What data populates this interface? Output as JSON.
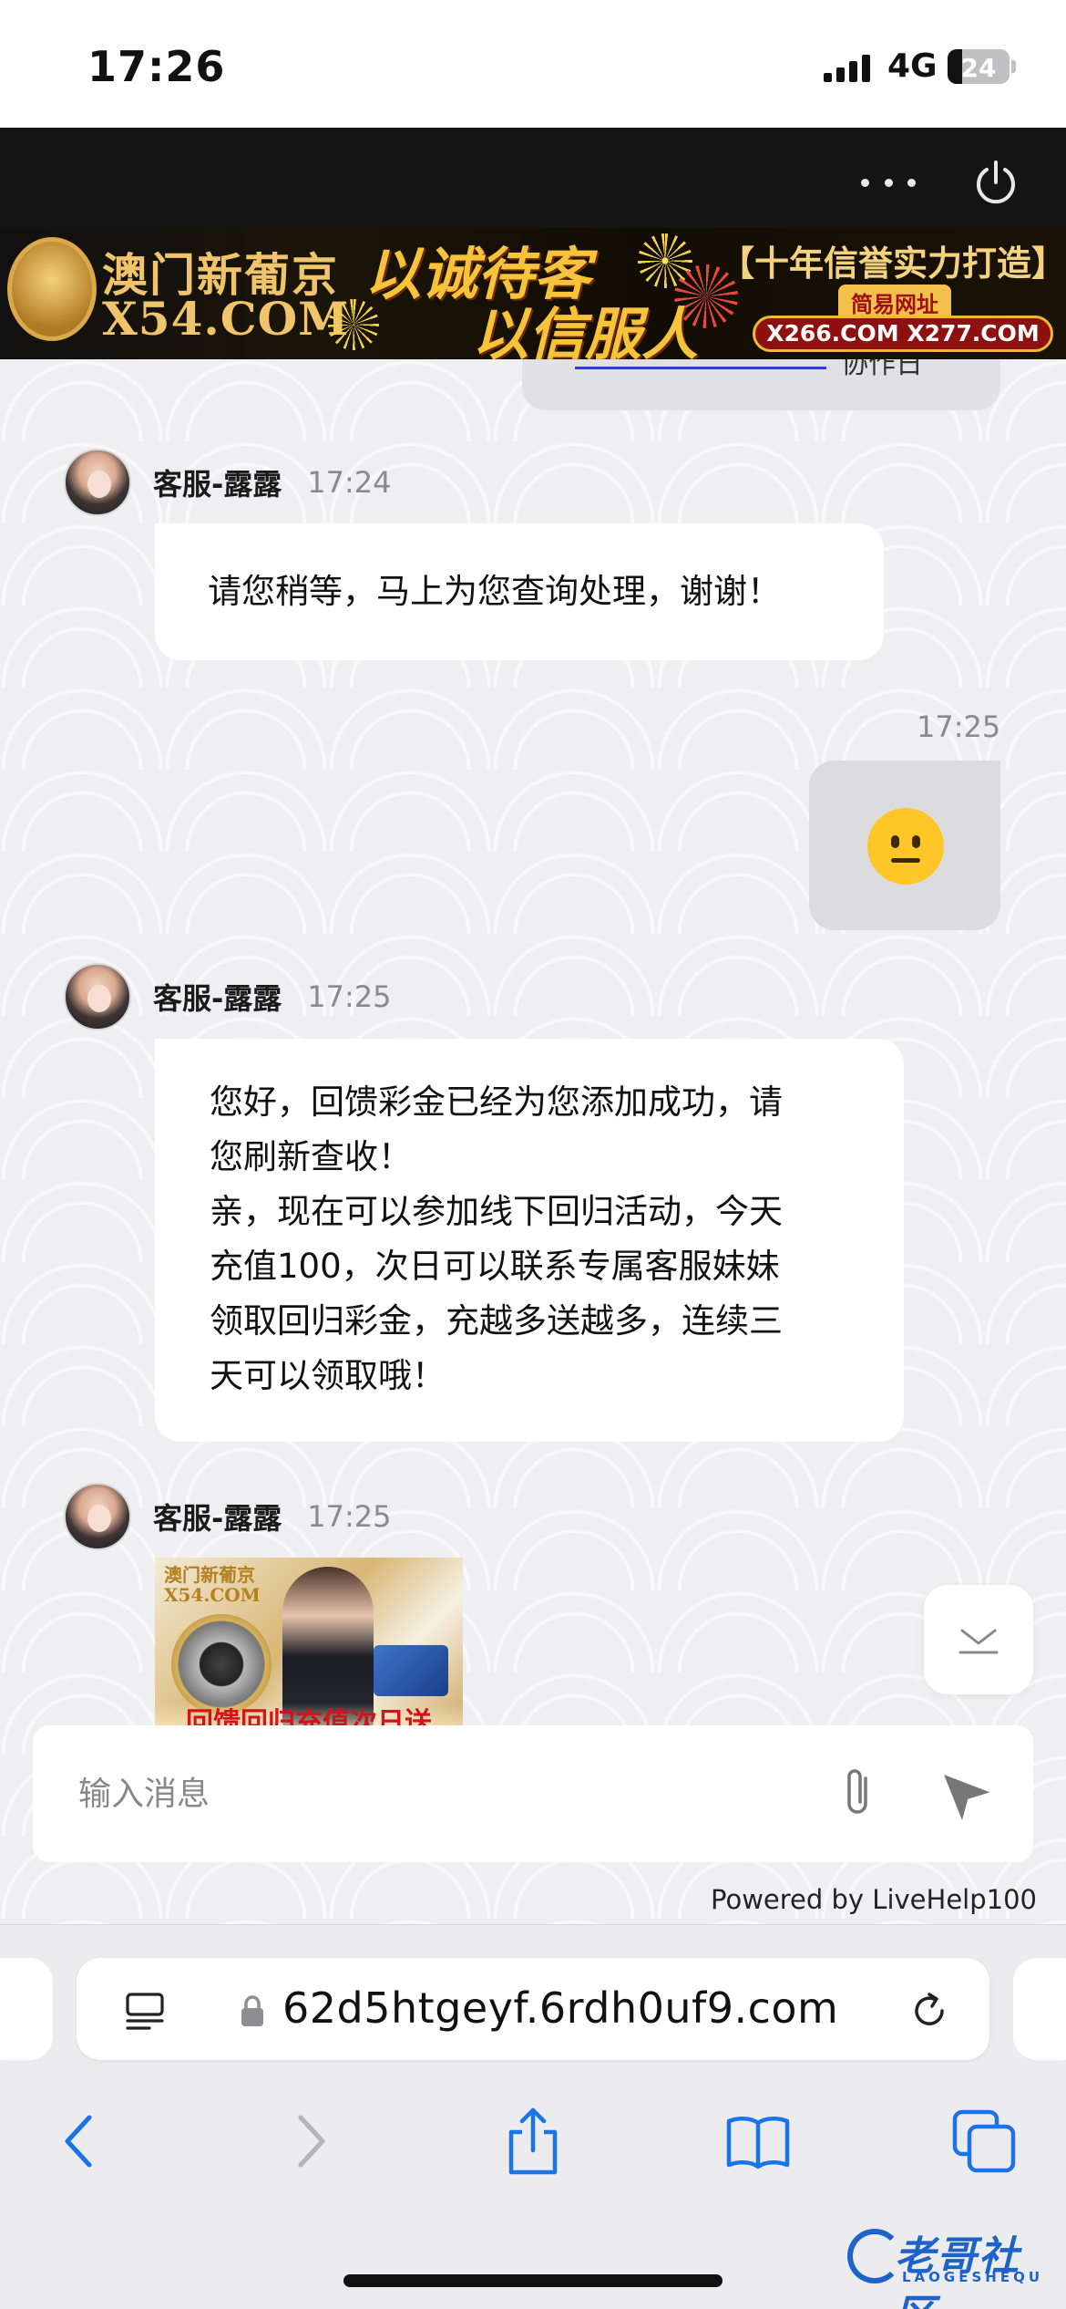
{
  "status_bar": {
    "time": "17:26",
    "network": "4G",
    "battery_level": "24",
    "battery_fraction": 0.24
  },
  "header": {
    "more_icon": "ellipsis-icon",
    "power_icon": "power-icon"
  },
  "banner": {
    "logo_cn": "澳门新葡京",
    "logo_en": "X54.COM",
    "slogan_line1": "以诚待客",
    "slogan_line2": "以信服人",
    "promise": "【十年信誉实力打造】",
    "url_label": "简易网址",
    "urls": "X266.COM  X277.COM"
  },
  "chat": {
    "previous_fragment": "协作日",
    "messages": [
      {
        "sender": "客服-露露",
        "time": "17:24",
        "text": "请您稍等，马上为您查询处理，谢谢！"
      },
      {
        "sender": "me",
        "time": "17:25",
        "emoji": "neutral-face-emoji"
      },
      {
        "sender": "客服-露露",
        "time": "17:25",
        "lines": [
          "您好，回馈彩金已经为您添加成功，请",
          "您刷新查收！",
          "亲，现在可以参加线下回归活动，今天",
          "充值100，次日可以联系专属客服妹妹",
          "领取回归彩金，充越多送越多，连续三",
          "天可以领取哦！"
        ]
      },
      {
        "sender": "客服-露露",
        "time": "17:25",
        "image": {
          "logo_cn": "澳门新葡京",
          "logo_en": "X54.COM",
          "caption": "回馈回归充值次日送"
        }
      }
    ]
  },
  "composer": {
    "placeholder": "输入消息",
    "attach_icon": "paperclip-icon",
    "send_icon": "send-icon"
  },
  "powered_by": "Powered by LiveHelp100",
  "browser": {
    "url": "62d5htgeyf.6rdh0uf9.com",
    "reader_icon": "page-menu-icon",
    "lock_icon": "lock-icon",
    "reload_icon": "reload-icon"
  },
  "toolbar": {
    "back_icon": "chevron-left-icon",
    "forward_icon": "chevron-right-icon",
    "share_icon": "share-icon",
    "bookmarks_icon": "book-icon",
    "tabs_icon": "tabs-icon"
  },
  "watermark": {
    "text": "老哥社区",
    "sub": "LAOGESHEQU"
  },
  "colors": {
    "accent_blue": "#1a73e8",
    "emoji_yellow": "#ffc627",
    "banner_gold": "#f6c33a"
  }
}
